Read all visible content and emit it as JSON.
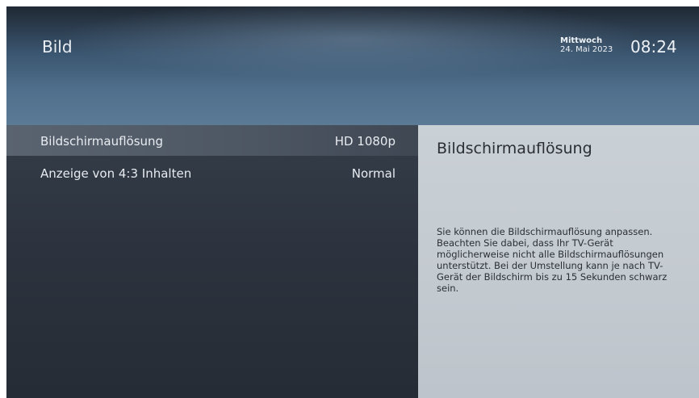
{
  "header": {
    "title": "Bild",
    "weekday": "Mittwoch",
    "date": "24. Mai 2023",
    "time": "08:24"
  },
  "menu": {
    "items": [
      {
        "label": "Bildschirmauflösung",
        "value": "HD 1080p",
        "selected": true
      },
      {
        "label": "Anzeige von 4:3 Inhalten",
        "value": "Normal",
        "selected": false
      }
    ]
  },
  "info": {
    "title": "Bildschirmauflösung",
    "description": "Sie können die Bildschirmauflösung anpassen. Beachten Sie dabei, dass Ihr TV-Gerät möglicherweise nicht alle Bildschirmauflösungen unterstützt. Bei der Umstellung kann je nach TV-Gerät der Bildschirm bis zu 15 Sekunden schwarz sein."
  },
  "colors": {
    "selected_row": "#56606c",
    "info_pane": "#c6cdd3",
    "header_accent": "#4f6f8c"
  }
}
